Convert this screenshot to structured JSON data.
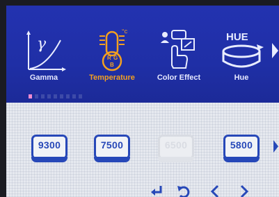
{
  "menu": {
    "items": [
      {
        "label": "Gamma",
        "icon": "gamma-curve-icon"
      },
      {
        "label": "Temperature",
        "icon": "thermometer-icon",
        "selected": true
      },
      {
        "label": "Color Effect",
        "icon": "color-effect-icon"
      },
      {
        "label": "Hue",
        "icon": "hue-icon"
      }
    ],
    "hue_icon_text": "HUE",
    "gamma_symbol": "γ",
    "thermo_unit": "°c",
    "thermo_letters": [
      "R",
      "G",
      "B"
    ]
  },
  "temperature_presets": [
    {
      "value": "9300",
      "state": "normal"
    },
    {
      "value": "7500",
      "state": "normal"
    },
    {
      "value": "6500",
      "state": "disabled"
    },
    {
      "value": "5800",
      "state": "normal"
    }
  ],
  "bottom_nav": {
    "icons": [
      "enter-icon",
      "return-icon",
      "left-icon",
      "right-icon"
    ]
  },
  "colors": {
    "menu_background": "#2131ac",
    "selected_label": "#f3a020",
    "preset_blue": "#2748b8"
  }
}
